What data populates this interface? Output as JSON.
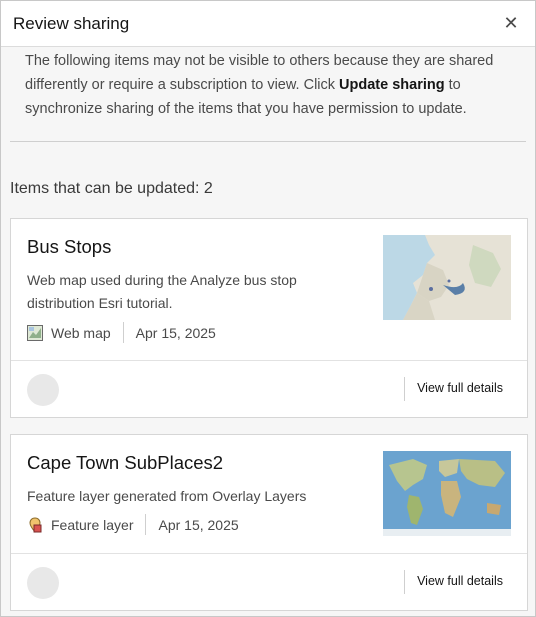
{
  "dialog": {
    "title": "Review sharing",
    "close_icon": "close-icon",
    "intro_before": "The following items may not be visible to others because they are shared differently or require a subscription to view. Click ",
    "intro_bold": "Update sharing",
    "intro_after": " to synchronize sharing of the items that you have permission to update.",
    "section_title": "Items that can be updated: 2"
  },
  "items": [
    {
      "title": "Bus Stops",
      "description": "Web map used during the Analyze bus stop distribution Esri tutorial.",
      "type_icon": "web-map-icon",
      "type": "Web map",
      "date": "Apr 15, 2025",
      "thumbnail": "map-thumbnail",
      "details_label": "View full details"
    },
    {
      "title": "Cape Town SubPlaces2",
      "description": "Feature layer generated from Overlay Layers",
      "type_icon": "feature-layer-icon",
      "type": "Feature layer",
      "date": "Apr 15, 2025",
      "thumbnail": "world-map-thumbnail",
      "details_label": "View full details"
    }
  ]
}
